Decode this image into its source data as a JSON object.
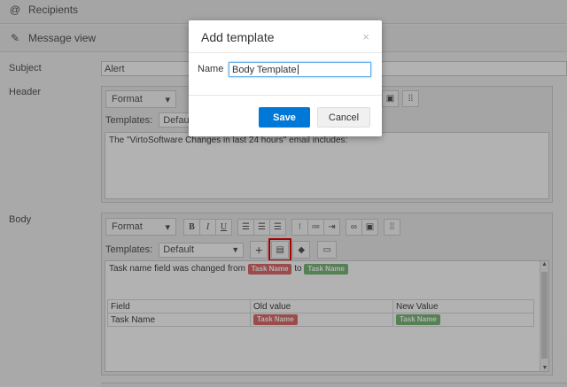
{
  "sections": {
    "recipients": {
      "label": "Recipients",
      "icon": "@"
    },
    "message_view": {
      "label": "Message view",
      "icon": "✎"
    }
  },
  "fields": {
    "subject": {
      "label": "Subject",
      "value": "Alert"
    },
    "header": {
      "label": "Header"
    },
    "body": {
      "label": "Body"
    }
  },
  "toolbar": {
    "format_label": "Format",
    "templates_label": "Templates:",
    "template_value": "Default",
    "buttons": {
      "bold": "B",
      "italic": "I",
      "underline": "U",
      "add": "+"
    }
  },
  "header_editor": {
    "content": "The \"VirtoSoftware Changes in last 24 hours\" email includes:"
  },
  "body_editor": {
    "line_prefix": "Task name field was changed from",
    "line_to": "to",
    "old_pill": "Task Name",
    "new_pill": "Task Name",
    "table": {
      "headers": [
        "Field",
        "Old value",
        "New Value"
      ],
      "row": {
        "field": "Task Name",
        "old": "Task Name",
        "new": "Task Name"
      }
    }
  },
  "modal": {
    "title": "Add template",
    "close": "×",
    "name_label": "Name",
    "name_value": "Body Template",
    "save_label": "Save",
    "cancel_label": "Cancel"
  },
  "colors": {
    "save": "#0078d7",
    "pill_old": "#e06c6c",
    "pill_new": "#7ab97a",
    "highlight": "#e00000"
  }
}
